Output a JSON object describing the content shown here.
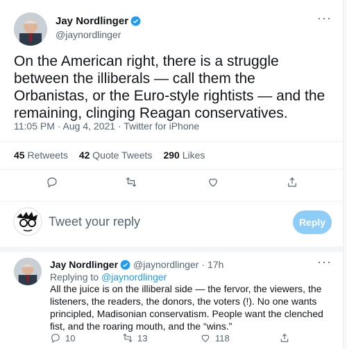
{
  "tweet": {
    "author_name": "Jay Nordlinger",
    "author_handle": "@jaynordlinger",
    "text": "On the American right, there is a struggle between the illiberals — call them the Orbanistas, or the Euro-style rightists — and the remaining, clinging Reagan conservatives.",
    "timestamp": "11:05 PM · Aug 4, 2021 · Twitter for iPhone",
    "stats": {
      "retweets_count": "45",
      "retweets_label": "Retweets",
      "quote_count": "42",
      "quote_label": "Quote Tweets",
      "likes_count": "290",
      "likes_label": "Likes"
    },
    "more": "···"
  },
  "composer": {
    "placeholder": "Tweet your reply",
    "button": "Reply"
  },
  "reply": {
    "author_name": "Jay Nordlinger",
    "author_handle": "@jaynordlinger",
    "time": "· 17h",
    "replying_prefix": "Replying to",
    "replying_handle": "@jaynordlinger",
    "text": "All the juice is on the illiberal side — the fervor, the viewers, the listeners, the readers, the donors, the voters (!). No one wants principled, Madisonian conservatism. People want the clenched fist, and the roaring mouth, and the “wins.”",
    "replies": "10",
    "retweets": "13",
    "likes": "118",
    "more": "···"
  },
  "colors": {
    "accent": "#1d9bf0",
    "reply_button_disabled": "#8ecdf7",
    "muted_text": "#536471"
  }
}
